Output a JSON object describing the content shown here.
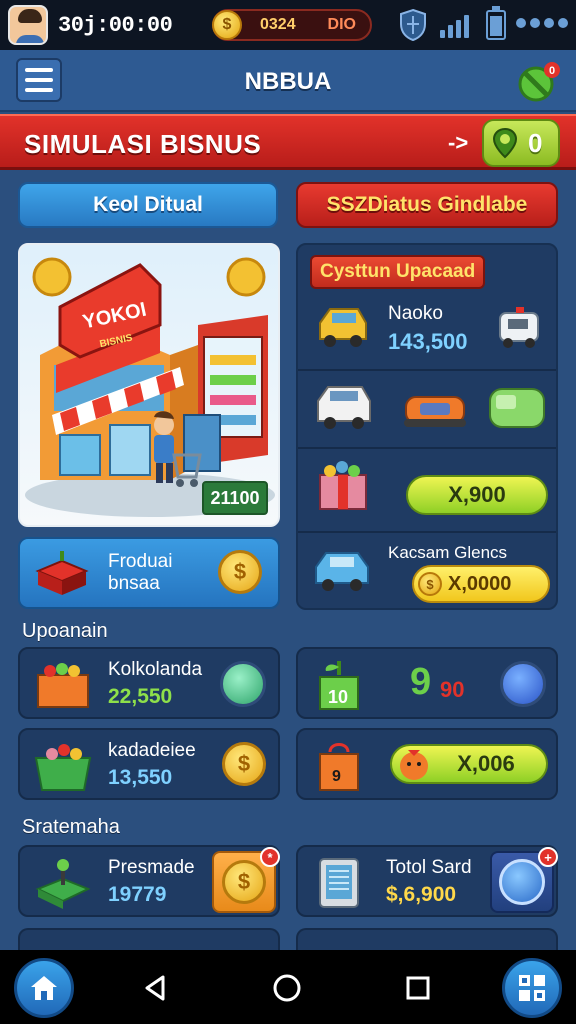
{
  "status": {
    "clock": "30j:00:00",
    "currency_a": "0324",
    "currency_b": "DIO",
    "coin_symbol": "$"
  },
  "header": {
    "title": "NBBUA"
  },
  "banner": {
    "title": "SIMULASI BISNUS",
    "arrow": "->",
    "pin_count": "0"
  },
  "tabs": {
    "left": "Keol Ditual",
    "right": "SSZDiatus Gindlabe"
  },
  "shop": {
    "sign": "YOKOI",
    "subsign": "BISNIS",
    "price": "21100",
    "coin_symbol": "$"
  },
  "upgrade": {
    "label": "Cysttun Upacaad",
    "vehicle_name": "Naoko",
    "vehicle_value": "143,500",
    "buy_button": "X,900",
    "kacam_name": "Kacsam Glencs",
    "kacam_button": "X,0000"
  },
  "product": {
    "line1": "Froduai",
    "line2": "bnsaa",
    "coin_symbol": "$"
  },
  "sections": {
    "upgrades": "Upoanain",
    "systems": "Sratemaha"
  },
  "rows": [
    {
      "name": "Kolkolanda",
      "value": "22,550"
    },
    {
      "name": "kadadeiee",
      "value": "13,550"
    },
    {
      "name": "Presmade",
      "value": "19779"
    },
    {
      "name": "Totol Sard",
      "value": "$,6,900"
    }
  ],
  "mini": {
    "box_num": "10",
    "nine": "9",
    "ninety": "90",
    "box_num2": "9",
    "btn_value": "X,006"
  },
  "colors": {
    "accent_red": "#e2322a",
    "accent_blue": "#2e5a92",
    "accent_green": "#8cbc22",
    "coin": "#f1c71d"
  },
  "icons": {
    "home": "home-icon",
    "grid": "grid-icon",
    "back": "back-icon",
    "circle": "home-circle-icon",
    "square": "recents-icon"
  }
}
